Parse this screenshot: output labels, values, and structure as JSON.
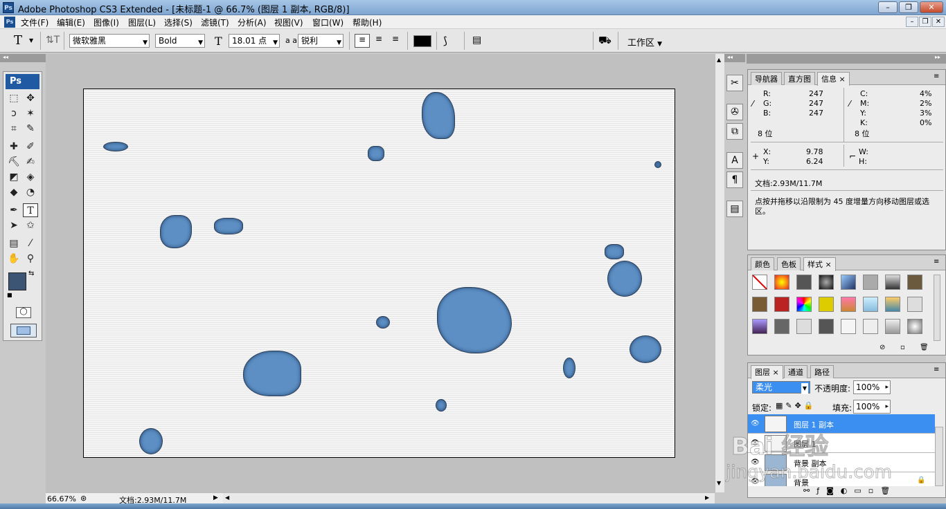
{
  "window": {
    "title": "Adobe Photoshop CS3 Extended - [未标题-1 @ 66.7% (图层 1 副本, RGB/8)]",
    "logo": "Ps"
  },
  "menu": [
    "文件(F)",
    "编辑(E)",
    "图像(I)",
    "图层(L)",
    "选择(S)",
    "滤镜(T)",
    "分析(A)",
    "视图(V)",
    "窗口(W)",
    "帮助(H)"
  ],
  "options": {
    "tool_letter": "T",
    "font_family": "微软雅黑",
    "font_style": "Bold",
    "font_size": "18.01 点",
    "aa_icon": "a a",
    "antialias": "锐利",
    "color": "#000000",
    "workspace": "工作区"
  },
  "toolbox": {
    "logo": "Ps"
  },
  "status": {
    "zoom": "66.67%",
    "doc": "文档:2.93M/11.7M"
  },
  "info_panel": {
    "tabs": [
      "导航器",
      "直方图",
      "信息"
    ],
    "rgb": [
      {
        "label": "R:",
        "value": "247"
      },
      {
        "label": "G:",
        "value": "247"
      },
      {
        "label": "B:",
        "value": "247"
      }
    ],
    "cmyk": [
      {
        "label": "C:",
        "value": "4%"
      },
      {
        "label": "M:",
        "value": "2%"
      },
      {
        "label": "Y:",
        "value": "3%"
      },
      {
        "label": "K:",
        "value": "0%"
      }
    ],
    "bit_left": "8 位",
    "bit_right": "8 位",
    "x_label": "X:",
    "x_value": "9.78",
    "y_label": "Y:",
    "y_value": "6.24",
    "w_label": "W:",
    "h_label": "H:",
    "doc": "文档:2.93M/11.7M",
    "hint": "点按并拖移以沿限制为 45 度增量方向移动图层或选区。"
  },
  "styles_panel": {
    "tabs": [
      "颜色",
      "色板",
      "样式"
    ]
  },
  "layers_panel": {
    "tabs": [
      "图层",
      "通道",
      "路径"
    ],
    "blend_mode": "柔光",
    "opacity_label": "不透明度:",
    "opacity": "100%",
    "lock_label": "锁定:",
    "fill_label": "填充:",
    "fill": "100%",
    "layers": [
      {
        "name": "图层 1 副本"
      },
      {
        "name": "图层 1"
      },
      {
        "name": "背景 副本"
      },
      {
        "name": "背景"
      }
    ]
  },
  "watermark": {
    "line1": "Bai 经验",
    "line2": "jingyan.baidu.com"
  },
  "colors": {
    "foreground": "#3c5574",
    "background": "#ffffff",
    "layer_selected": "#3a8ff0"
  }
}
